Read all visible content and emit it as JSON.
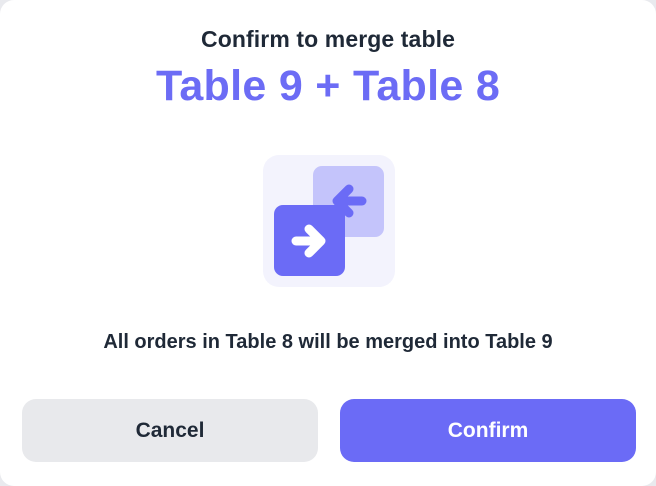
{
  "dialog": {
    "subtitle": "Confirm to merge table",
    "title": "Table 9 + Table 8",
    "icon": "merge-tables-icon",
    "message": "All orders in Table 8 will be merged into Table 9",
    "cancel_label": "Cancel",
    "confirm_label": "Confirm"
  },
  "colors": {
    "accent": "#6b6bf6",
    "accent_light": "#c4c4fb",
    "icon_bg": "#f3f3fd",
    "cancel_bg": "#e8e9ec",
    "text_dark": "#1f2937"
  }
}
